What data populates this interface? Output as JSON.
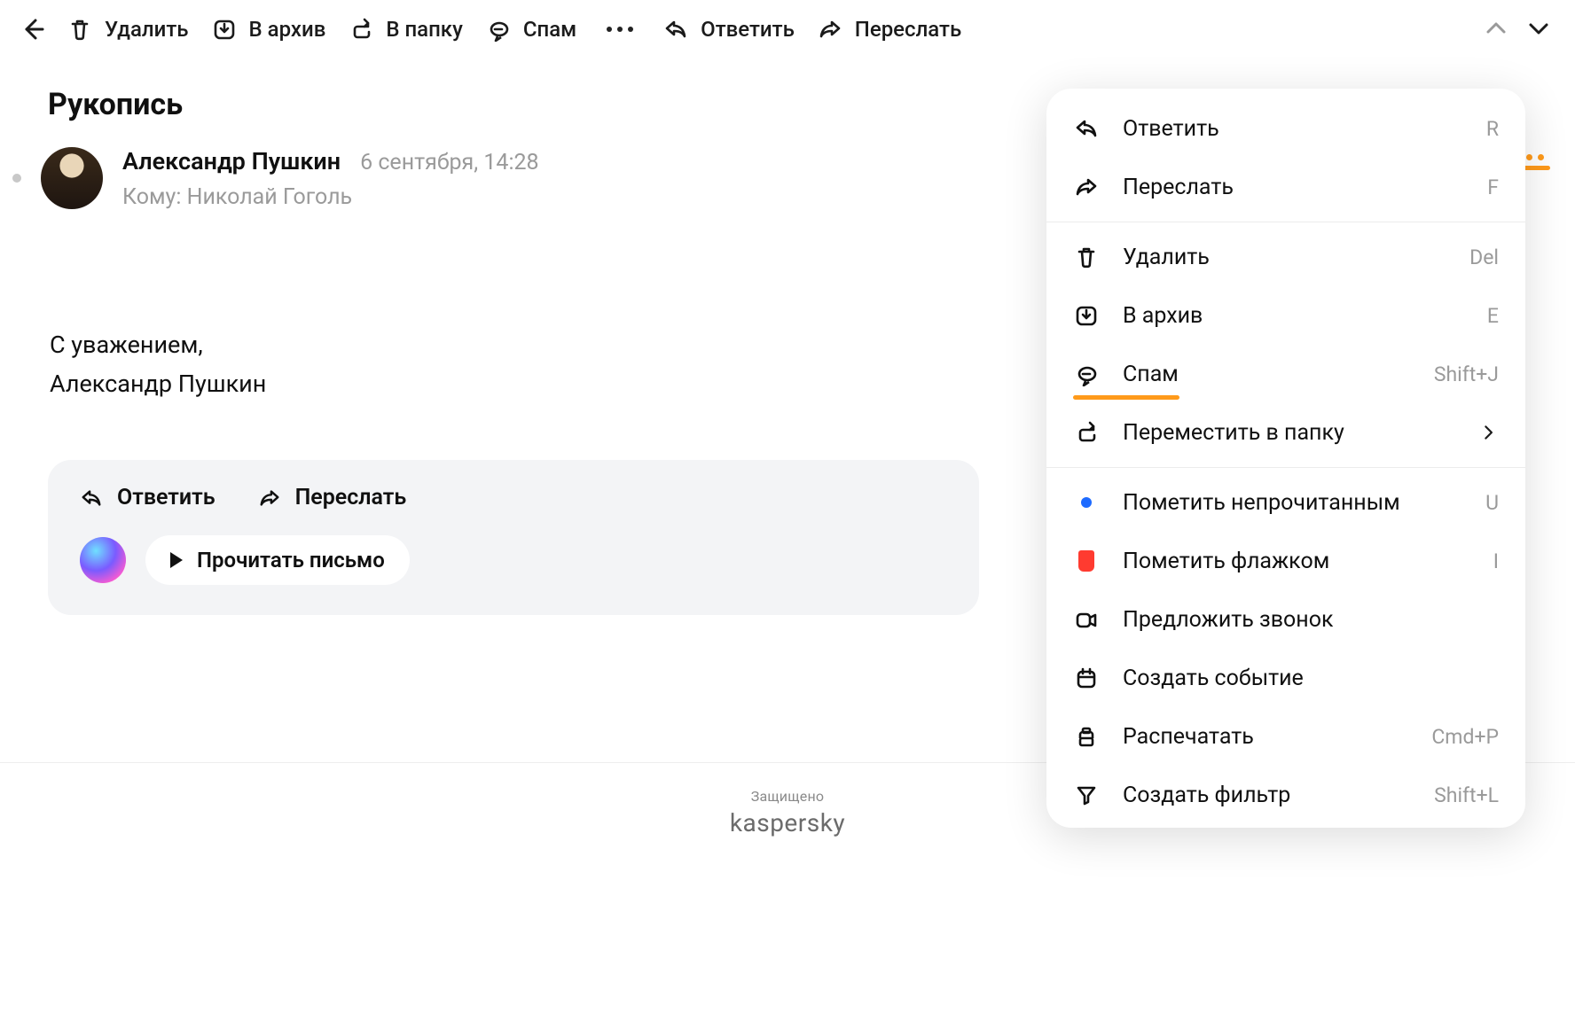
{
  "toolbar": {
    "delete": "Удалить",
    "archive": "В архив",
    "to_folder": "В папку",
    "spam": "Спам",
    "reply": "Ответить",
    "forward": "Переслать"
  },
  "subject": "Рукопись",
  "message": {
    "sender": "Александр Пушкин",
    "date": "6 сентября, 14:28",
    "to_prefix": "Кому: ",
    "to_name": "Николай Гоголь",
    "body_line1": "С уважением,",
    "body_line2": "Александр Пушкин"
  },
  "action_card": {
    "reply": "Ответить",
    "forward": "Переслать",
    "read": "Прочитать письмо"
  },
  "footer": {
    "protected": "Защищено",
    "brand": "kaspersky"
  },
  "menu": {
    "reply": {
      "label": "Ответить",
      "short": "R"
    },
    "forward": {
      "label": "Переслать",
      "short": "F"
    },
    "delete": {
      "label": "Удалить",
      "short": "Del"
    },
    "archive": {
      "label": "В архив",
      "short": "E"
    },
    "spam": {
      "label": "Спам",
      "short": "Shift+J"
    },
    "move": {
      "label": "Переместить в папку"
    },
    "unread": {
      "label": "Пометить непрочитанным",
      "short": "U"
    },
    "flag": {
      "label": "Пометить флажком",
      "short": "I"
    },
    "call": {
      "label": "Предложить звонок"
    },
    "event": {
      "label": "Создать событие"
    },
    "print": {
      "label": "Распечатать",
      "short": "Cmd+P"
    },
    "filter": {
      "label": "Создать фильтр",
      "short": "Shift+L"
    }
  }
}
